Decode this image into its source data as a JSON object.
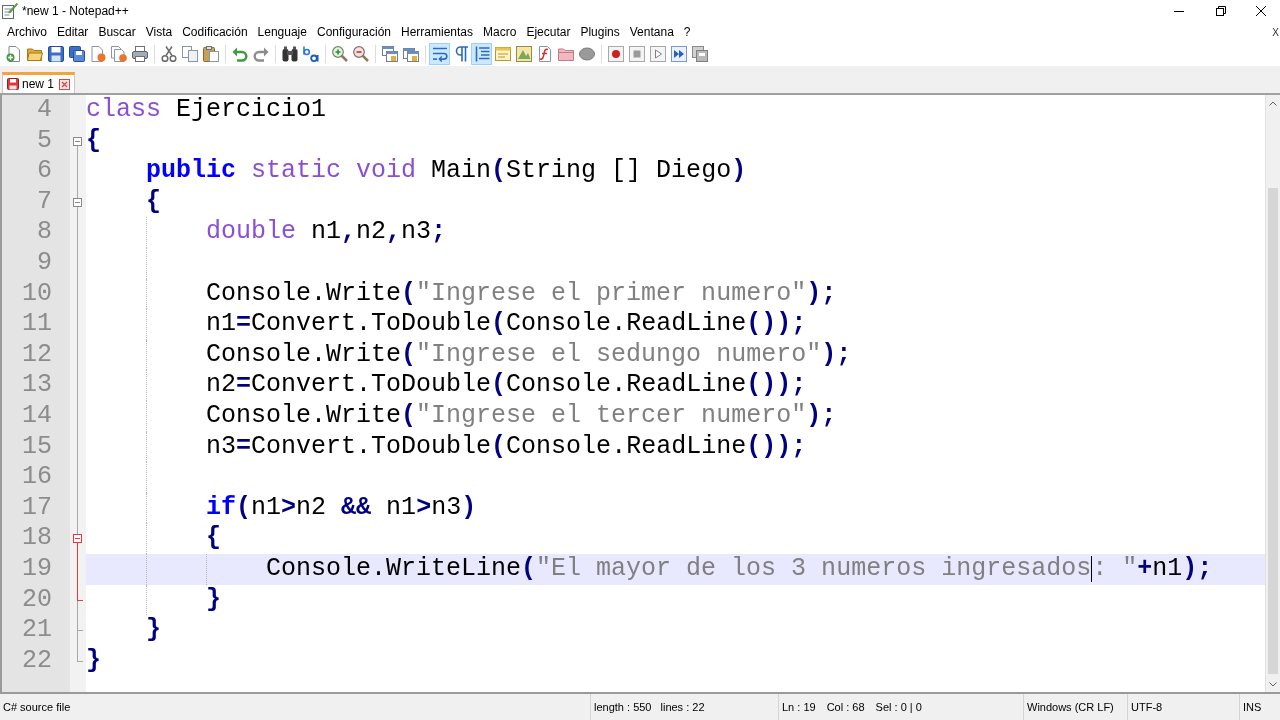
{
  "window": {
    "title": "*new 1 - Notepad++"
  },
  "menu_bar": {
    "items": [
      "Archivo",
      "Editar",
      "Buscar",
      "Vista",
      "Codificación",
      "Lenguaje",
      "Configuración",
      "Herramientas",
      "Macro",
      "Ejecutar",
      "Plugins",
      "Ventana",
      "?"
    ],
    "close_document": "X"
  },
  "toolbar": {
    "groups": [
      {
        "buttons": [
          {
            "kind": "new",
            "on": false
          },
          {
            "kind": "open",
            "on": false
          },
          {
            "kind": "save",
            "on": false
          },
          {
            "kind": "saveall",
            "on": false
          },
          {
            "kind": "close",
            "on": false
          },
          {
            "kind": "closeall",
            "on": false
          },
          {
            "kind": "print",
            "on": false
          }
        ]
      },
      {
        "buttons": [
          {
            "kind": "cut",
            "on": false
          },
          {
            "kind": "copy",
            "on": false
          },
          {
            "kind": "paste",
            "on": false
          }
        ]
      },
      {
        "buttons": [
          {
            "kind": "undo",
            "on": false
          },
          {
            "kind": "redo",
            "on": false
          }
        ]
      },
      {
        "buttons": [
          {
            "kind": "find",
            "on": false
          },
          {
            "kind": "replace",
            "on": false
          }
        ]
      },
      {
        "buttons": [
          {
            "kind": "zoomin",
            "on": false
          },
          {
            "kind": "zoomout",
            "on": false
          }
        ]
      },
      {
        "buttons": [
          {
            "kind": "syncv",
            "on": false
          },
          {
            "kind": "synch",
            "on": false
          }
        ]
      },
      {
        "buttons": [
          {
            "kind": "wrap",
            "on": true
          },
          {
            "kind": "pilcrow",
            "on": false
          },
          {
            "kind": "indent",
            "on": true
          },
          {
            "kind": "udl",
            "on": false
          },
          {
            "kind": "docmap",
            "on": false
          },
          {
            "kind": "funclist",
            "on": false
          },
          {
            "kind": "folder",
            "on": false
          },
          {
            "kind": "monitor",
            "on": false
          }
        ]
      },
      {
        "buttons": [
          {
            "kind": "record",
            "on": false
          },
          {
            "kind": "stop",
            "on": false
          },
          {
            "kind": "play",
            "on": false
          },
          {
            "kind": "playmulti",
            "on": false
          },
          {
            "kind": "savemacro",
            "on": false
          }
        ]
      }
    ]
  },
  "tabs": [
    {
      "label": "new 1",
      "selected": true,
      "modified": true
    }
  ],
  "editor": {
    "lines": [
      {
        "number": "4",
        "current": false,
        "tokens": [
          {
            "kind": "type",
            "text": "class"
          },
          {
            "kind": "plain",
            "text": " Ejercicio1"
          }
        ]
      },
      {
        "number": "5",
        "current": false,
        "fold": {
          "kind": "head",
          "active": false
        },
        "tokens": [
          {
            "kind": "operator",
            "text": "{"
          }
        ]
      },
      {
        "number": "6",
        "current": false,
        "fold": {
          "kind": "body",
          "active": false
        },
        "tokens": [
          {
            "kind": "keyword",
            "text": "    public"
          },
          {
            "kind": "type",
            "text": " static"
          },
          {
            "kind": "type",
            "text": " void"
          },
          {
            "kind": "plain",
            "text": " Main"
          },
          {
            "kind": "operator",
            "text": "("
          },
          {
            "kind": "plain",
            "text": "String [] Diego"
          },
          {
            "kind": "operator",
            "text": ")"
          }
        ]
      },
      {
        "number": "7",
        "current": false,
        "fold": {
          "kind": "head",
          "active": false
        },
        "tokens": [
          {
            "kind": "operator",
            "text": "    {"
          }
        ]
      },
      {
        "number": "8",
        "current": false,
        "fold": {
          "kind": "body",
          "active": false
        },
        "tokens": [
          {
            "kind": "type",
            "text": "        double"
          },
          {
            "kind": "plain",
            "text": " n1"
          },
          {
            "kind": "operator",
            "text": ","
          },
          {
            "kind": "plain",
            "text": "n2"
          },
          {
            "kind": "operator",
            "text": ","
          },
          {
            "kind": "plain",
            "text": "n3"
          },
          {
            "kind": "operator",
            "text": ";"
          }
        ]
      },
      {
        "number": "9",
        "current": false,
        "fold": {
          "kind": "body",
          "active": false
        }
      },
      {
        "number": "10",
        "current": false,
        "fold": {
          "kind": "body",
          "active": false
        },
        "tokens": [
          {
            "kind": "plain",
            "text": "        Console.Write"
          },
          {
            "kind": "operator",
            "text": "("
          },
          {
            "kind": "string",
            "text": "\"Ingrese el primer numero\""
          },
          {
            "kind": "operator",
            "text": ");"
          }
        ]
      },
      {
        "number": "11",
        "current": false,
        "fold": {
          "kind": "body",
          "active": false
        },
        "tokens": [
          {
            "kind": "plain",
            "text": "        n1"
          },
          {
            "kind": "operator",
            "text": "="
          },
          {
            "kind": "plain",
            "text": "Convert.ToDouble"
          },
          {
            "kind": "operator",
            "text": "("
          },
          {
            "kind": "plain",
            "text": "Console.ReadLine"
          },
          {
            "kind": "operator",
            "text": "());"
          }
        ]
      },
      {
        "number": "12",
        "current": false,
        "fold": {
          "kind": "body",
          "active": false
        },
        "tokens": [
          {
            "kind": "plain",
            "text": "        Console.Write"
          },
          {
            "kind": "operator",
            "text": "("
          },
          {
            "kind": "string",
            "text": "\"Ingrese el sedungo numero\""
          },
          {
            "kind": "operator",
            "text": ");"
          }
        ]
      },
      {
        "number": "13",
        "current": false,
        "fold": {
          "kind": "body",
          "active": false
        },
        "tokens": [
          {
            "kind": "plain",
            "text": "        n2"
          },
          {
            "kind": "operator",
            "text": "="
          },
          {
            "kind": "plain",
            "text": "Convert.ToDouble"
          },
          {
            "kind": "operator",
            "text": "("
          },
          {
            "kind": "plain",
            "text": "Console.ReadLine"
          },
          {
            "kind": "operator",
            "text": "());"
          }
        ]
      },
      {
        "number": "14",
        "current": false,
        "fold": {
          "kind": "body",
          "active": false
        },
        "tokens": [
          {
            "kind": "plain",
            "text": "        Console.Write"
          },
          {
            "kind": "operator",
            "text": "("
          },
          {
            "kind": "string",
            "text": "\"Ingrese el tercer numero\""
          },
          {
            "kind": "operator",
            "text": ");"
          }
        ]
      },
      {
        "number": "15",
        "current": false,
        "fold": {
          "kind": "body",
          "active": false
        },
        "tokens": [
          {
            "kind": "plain",
            "text": "        n3"
          },
          {
            "kind": "operator",
            "text": "="
          },
          {
            "kind": "plain",
            "text": "Convert.ToDouble"
          },
          {
            "kind": "operator",
            "text": "("
          },
          {
            "kind": "plain",
            "text": "Console.ReadLine"
          },
          {
            "kind": "operator",
            "text": "());"
          }
        ]
      },
      {
        "number": "16",
        "current": false,
        "fold": {
          "kind": "body",
          "active": false
        }
      },
      {
        "number": "17",
        "current": false,
        "fold": {
          "kind": "body",
          "active": false
        },
        "tokens": [
          {
            "kind": "keyword",
            "text": "        if"
          },
          {
            "kind": "operator",
            "text": "("
          },
          {
            "kind": "plain",
            "text": "n1"
          },
          {
            "kind": "operator",
            "text": ">"
          },
          {
            "kind": "plain",
            "text": "n2 "
          },
          {
            "kind": "operator",
            "text": "&&"
          },
          {
            "kind": "plain",
            "text": " n1"
          },
          {
            "kind": "operator",
            "text": ">"
          },
          {
            "kind": "plain",
            "text": "n3"
          },
          {
            "kind": "operator",
            "text": ")"
          }
        ]
      },
      {
        "number": "18",
        "current": false,
        "fold": {
          "kind": "head",
          "active": true
        },
        "tokens": [
          {
            "kind": "operator",
            "text": "        {"
          }
        ]
      },
      {
        "number": "19",
        "current": true,
        "fold": {
          "kind": "body",
          "active": true
        },
        "tokens": [
          {
            "kind": "plain",
            "text": "            Console.WriteLine"
          },
          {
            "kind": "operator",
            "text": "("
          },
          {
            "kind": "string",
            "text": "\"El mayor de los 3 numeros ingresados"
          },
          {
            "kind": "caret"
          },
          {
            "kind": "string",
            "text": ": \""
          },
          {
            "kind": "operator",
            "text": "+"
          },
          {
            "kind": "plain",
            "text": "n1"
          },
          {
            "kind": "operator",
            "text": ");"
          }
        ]
      },
      {
        "number": "20",
        "current": false,
        "fold": {
          "kind": "branch",
          "active": true
        },
        "tokens": [
          {
            "kind": "operator",
            "text": "        }"
          }
        ]
      },
      {
        "number": "21",
        "current": false,
        "fold": {
          "kind": "branch",
          "active": false
        },
        "tokens": [
          {
            "kind": "operator",
            "text": "    }"
          }
        ]
      },
      {
        "number": "22",
        "current": false,
        "fold": {
          "kind": "tail",
          "active": false
        },
        "tokens": [
          {
            "kind": "operator",
            "text": "}"
          }
        ]
      }
    ]
  },
  "status_bar": {
    "file_type": "C# source file",
    "length": "length : 550",
    "lines": "lines : 22",
    "line": "Ln : 19",
    "column": "Col : 68",
    "selection": "Sel : 0 | 0",
    "line_ending": "Windows (CR LF)",
    "encoding": "UTF-8",
    "mode": "INS"
  }
}
